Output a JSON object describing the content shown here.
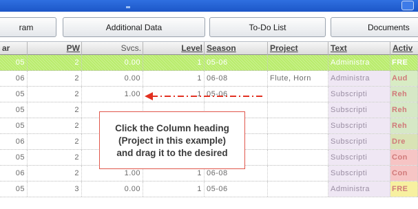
{
  "tabs": [
    {
      "label": "ram"
    },
    {
      "label": "Additional Data"
    },
    {
      "label": "To-Do List"
    },
    {
      "label": "Documents"
    }
  ],
  "columns": [
    "ar",
    "PW",
    "Svcs.",
    "Level",
    "Season",
    "Project",
    "Text",
    "Activ"
  ],
  "rows": [
    {
      "c0": "05",
      "pw": "2",
      "svcs": "0.00",
      "level": "1",
      "season": "05-06",
      "project": "",
      "text": "Administra",
      "act": "FRE"
    },
    {
      "c0": "06",
      "pw": "2",
      "svcs": "0.00",
      "level": "1",
      "season": "06-08",
      "project": "Flute, Horn",
      "text": "Administra",
      "act": "Aud"
    },
    {
      "c0": "05",
      "pw": "2",
      "svcs": "1.00",
      "level": "1",
      "season": "05-06",
      "project": "",
      "text": "Subscripti",
      "act": "Reh"
    },
    {
      "c0": "05",
      "pw": "2",
      "svcs": "",
      "level": "",
      "season": "",
      "project": "",
      "text": "Subscripti",
      "act": "Reh"
    },
    {
      "c0": "05",
      "pw": "2",
      "svcs": "",
      "level": "",
      "season": "",
      "project": "",
      "text": "Subscripti",
      "act": "Reh"
    },
    {
      "c0": "06",
      "pw": "2",
      "svcs": "",
      "level": "",
      "season": "",
      "project": "",
      "text": "Subscripti",
      "act": "Dre"
    },
    {
      "c0": "05",
      "pw": "2",
      "svcs": "",
      "level": "",
      "season": "",
      "project": "",
      "text": "Subscripti",
      "act": "Con"
    },
    {
      "c0": "06",
      "pw": "2",
      "svcs": "1.00",
      "level": "1",
      "season": "06-08",
      "project": "",
      "text": "Subscripti",
      "act": "Con"
    },
    {
      "c0": "05",
      "pw": "3",
      "svcs": "0.00",
      "level": "1",
      "season": "05-06",
      "project": "",
      "text": "Administra",
      "act": "FRE"
    }
  ],
  "activity_colors": [
    "#ffffff",
    "#d8ecc4",
    "#d6e8c6",
    "#d6e8c6",
    "#d6e8c6",
    "#d9e3b5",
    "#f6c4c4",
    "#f6c4c4",
    "#f7f0a0"
  ],
  "accent": {
    "selected_row": "#b9ec6c",
    "drag_arrow": "#e23020",
    "tooltip_border": "#e0554a"
  },
  "tooltip": {
    "line1": "Click the Column heading",
    "line2": "(Project in this example)",
    "line3": "and drag it to the desired"
  }
}
